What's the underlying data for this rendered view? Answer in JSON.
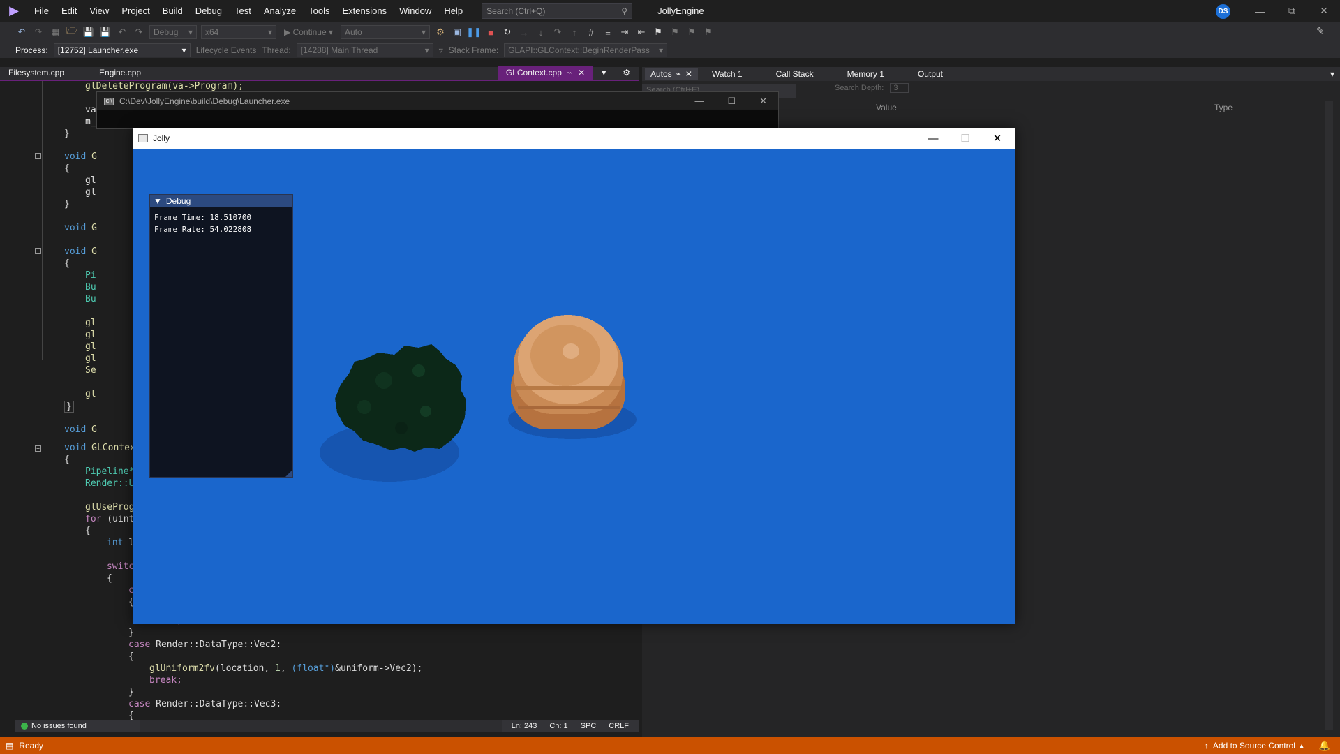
{
  "menubar": {
    "items": [
      "File",
      "Edit",
      "View",
      "Project",
      "Build",
      "Debug",
      "Test",
      "Analyze",
      "Tools",
      "Extensions",
      "Window",
      "Help"
    ],
    "search_placeholder": "Search (Ctrl+Q)",
    "solution_name": "JollyEngine",
    "avatar_initials": "DS"
  },
  "toolbar": {
    "config": "Debug",
    "platform": "x64",
    "continue_label": "Continue",
    "auto_label": "Auto"
  },
  "toolbar2": {
    "process_label": "Process:",
    "process_value": "[12752] Launcher.exe",
    "lifecycle_label": "Lifecycle Events",
    "thread_label": "Thread:",
    "thread_value": "[14288] Main Thread",
    "stack_label": "Stack Frame:",
    "stack_value": "GLAPI::GLContext::BeginRenderPass"
  },
  "doc_tabs": {
    "filesystem": "Filesystem.cpp",
    "engine": "Engine.cpp",
    "active": "GLContext.cpp"
  },
  "tool_tabs": {
    "autos": "Autos",
    "watch": "Watch 1",
    "callstack": "Call Stack",
    "memory": "Memory 1",
    "output": "Output"
  },
  "autos_pane": {
    "search_placeholder": "Search (Ctrl+E)",
    "search_depth_label": "Search Depth:",
    "search_depth_value": "3",
    "col_value": "Value",
    "col_type": "Type"
  },
  "code": {
    "l1": "glDeleteProgram(va->Program);",
    "l2": "va",
    "l3": "m_",
    "l4": "}",
    "l5_kw": "void",
    "l5_fn": " G",
    "l6": "{",
    "l7": "gl",
    "l8": "gl",
    "l9": "}",
    "l10_kw": "void",
    "l10_fn": " G",
    "l11_kw": "void",
    "l11_fn": " G",
    "l12": "{",
    "l13": "Pi",
    "l14": "Bu",
    "l15": "Bu",
    "l16": "gl",
    "l17": "gl",
    "l18": "gl",
    "l19": "gl",
    "l20": "Se",
    "l21": "gl",
    "l22": "}",
    "l23_kw": "void",
    "l23_fn": " G",
    "l24_kw": "void",
    "l24_fn": " GLContex",
    "l25": "{",
    "l26": "Pipeline*",
    "l27": "Render::U",
    "l28": "glUseProg",
    "l29_kw": "for",
    "l29_rest": " (uint",
    "l30": "{",
    "l31_kw": "int",
    "l31_rest": " l",
    "l32": "switc",
    "l33": "{",
    "l34": "c",
    "l35": "{",
    "l36": "break;",
    "l37": "}",
    "l38_kw": "case",
    "l38_rest": " Render::DataType::Vec2:",
    "l39": "{",
    "l40_fn": "glUniform2fv",
    "l40_a": "(location, ",
    "l40_num": "1",
    "l40_b": ", ",
    "l40_cast": "(float*)",
    "l40_c": "&uniform->Vec2);",
    "l41": "break;",
    "l42": "}",
    "l43_kw": "case",
    "l43_rest": " Render::DataType::Vec3:",
    "l44": "{"
  },
  "editor_status": {
    "issues": "No issues found",
    "line": "Ln: 243",
    "col": "Ch: 1",
    "spc": "SPC",
    "eol": "CRLF"
  },
  "console": {
    "title": "C:\\Dev\\JollyEngine\\build\\Debug\\Launcher.exe"
  },
  "jolly": {
    "title": "Jolly",
    "debug_title": "Debug",
    "frame_time": "Frame Time: 18.510700",
    "frame_rate": "Frame Rate: 54.022808"
  },
  "statusbar": {
    "ready": "Ready",
    "source_control": "Add to Source Control"
  },
  "colors": {
    "accent": "#68217a",
    "status": "#ca5100",
    "viewport": "#1a66cc"
  }
}
